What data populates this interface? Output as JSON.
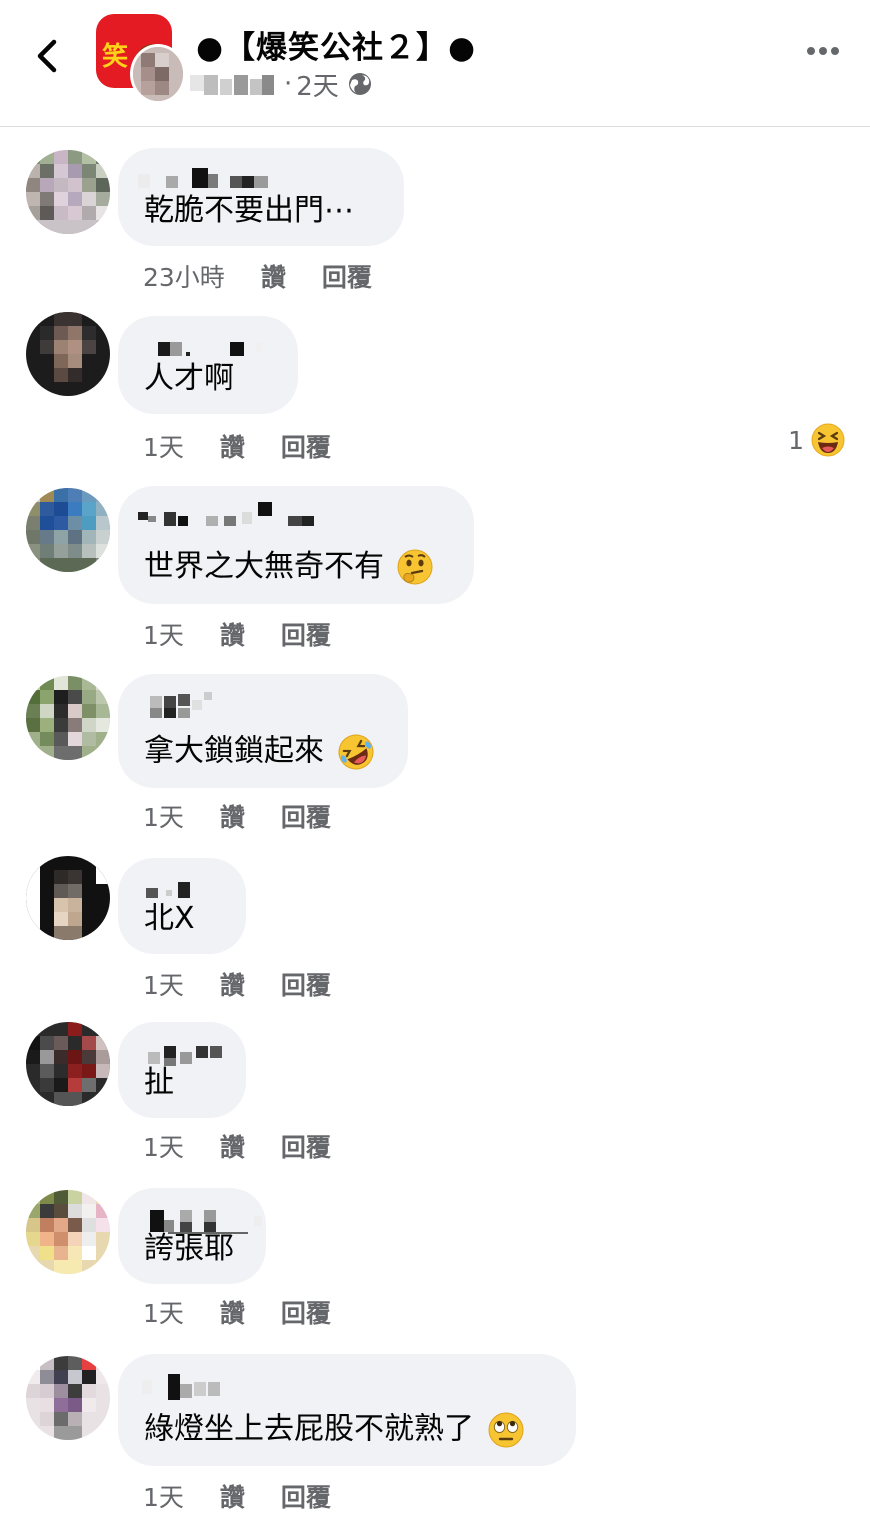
{
  "header": {
    "back_icon": "chevron-left-icon",
    "group_name": "●【爆笑公社２】●",
    "logo_text": "笑",
    "separator": "·",
    "post_time": "2天",
    "privacy_icon": "globe-icon",
    "more_icon": "more-horizontal-icon"
  },
  "comments": [
    {
      "text": "乾脆不要出門⋯",
      "time": "23小時",
      "like": "讚",
      "reply": "回覆"
    },
    {
      "text": "人才啊",
      "time": "1天",
      "like": "讚",
      "reply": "回覆",
      "reaction_count": "1",
      "reaction_icon": "laughing-emoji"
    },
    {
      "text": "世界之大無奇不有",
      "emoji": "thinking-face-emoji",
      "time": "1天",
      "like": "讚",
      "reply": "回覆"
    },
    {
      "text": "拿大鎖鎖起來",
      "emoji": "rolling-on-floor-laughing-emoji",
      "time": "1天",
      "like": "讚",
      "reply": "回覆"
    },
    {
      "text": "北X",
      "time": "1天",
      "like": "讚",
      "reply": "回覆"
    },
    {
      "text": "扯",
      "time": "1天",
      "like": "讚",
      "reply": "回覆"
    },
    {
      "text": "誇張耶",
      "time": "1天",
      "like": "讚",
      "reply": "回覆"
    },
    {
      "text": "綠燈坐上去屁股不就熟了",
      "emoji": "face-with-rolling-eyes-emoji",
      "time": "1天",
      "like": "讚",
      "reply": "回覆"
    }
  ],
  "colors": {
    "bubble": "#f0f2f5",
    "meta_text": "#65676b",
    "text": "#050505",
    "logo_red": "#e41b23"
  }
}
